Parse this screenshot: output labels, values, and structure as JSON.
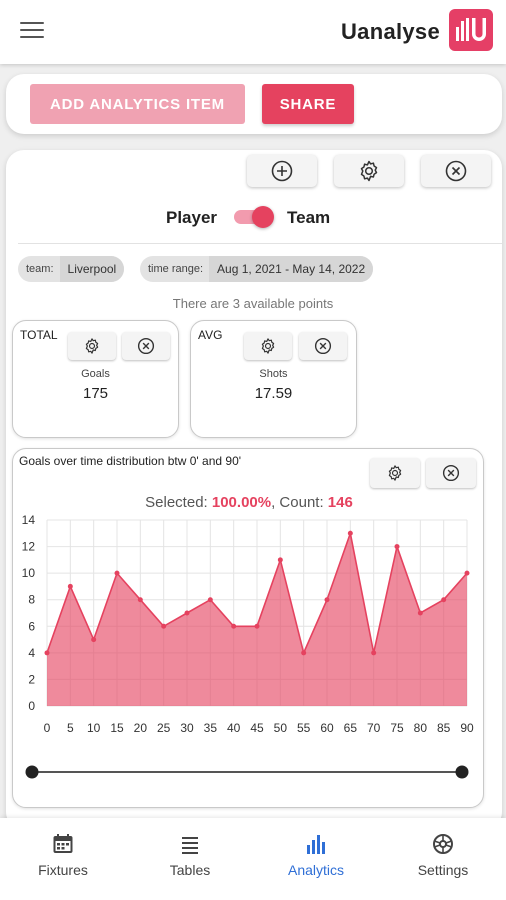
{
  "app": {
    "title": "Uanalyse",
    "logo_text": "ılU"
  },
  "toolbar": {
    "add_label": "ADD ANALYTICS ITEM",
    "share_label": "SHARE"
  },
  "toggle": {
    "left_label": "Player",
    "right_label": "Team",
    "selected": "Team"
  },
  "filters": [
    {
      "key": "team:",
      "value": "Liverpool"
    },
    {
      "key": "time range:",
      "value": "Aug 1, 2021 - May 14, 2022"
    }
  ],
  "points_info": "There are 3 available points",
  "stats": [
    {
      "type": "TOTAL",
      "name": "Goals",
      "value": "175"
    },
    {
      "type": "AVG",
      "name": "Shots",
      "value": "17.59"
    }
  ],
  "chart_card": {
    "title": "Goals over time distribution btw 0' and 90'",
    "selected_prefix": "Selected: ",
    "selected_value": "100.00%",
    "count_prefix": ", Count: ",
    "count_value": "146"
  },
  "slider": {
    "min": 0,
    "max": 90,
    "low": 0,
    "high": 90
  },
  "chart_data": {
    "type": "area",
    "x": [
      0,
      5,
      10,
      15,
      20,
      25,
      30,
      35,
      40,
      45,
      50,
      55,
      60,
      65,
      70,
      75,
      80,
      85,
      90
    ],
    "values": [
      4,
      9,
      5,
      10,
      8,
      6,
      7,
      8,
      6,
      6,
      11,
      4,
      8,
      13,
      4,
      12,
      7,
      8,
      10
    ],
    "ylim": [
      0,
      14
    ],
    "yticks": [
      0,
      2,
      4,
      6,
      8,
      10,
      12,
      14
    ],
    "xticks": [
      0,
      5,
      10,
      15,
      20,
      25,
      30,
      35,
      40,
      45,
      50,
      55,
      60,
      65,
      70,
      75,
      80,
      85,
      90
    ],
    "grid": true,
    "color": "#e5425f"
  },
  "nav": [
    {
      "label": "Fixtures",
      "icon": "calendar-icon"
    },
    {
      "label": "Tables",
      "icon": "list-icon"
    },
    {
      "label": "Analytics",
      "icon": "bar-chart-icon"
    },
    {
      "label": "Settings",
      "icon": "settings-icon"
    }
  ],
  "colors": {
    "accent": "#e5425f",
    "accent_light": "#f0a2b2",
    "nav_active": "#2f6fd6"
  }
}
